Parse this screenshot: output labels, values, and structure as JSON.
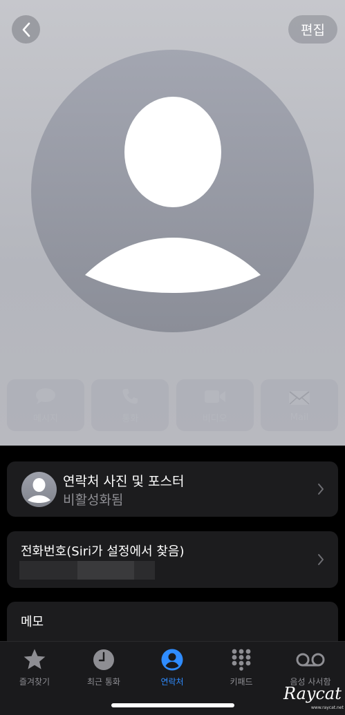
{
  "header": {
    "edit_label": "편집"
  },
  "actions": [
    {
      "label": "메시지",
      "icon": "message-icon"
    },
    {
      "label": "통화",
      "icon": "phone-icon"
    },
    {
      "label": "비디오",
      "icon": "video-icon"
    },
    {
      "label": "Mail",
      "icon": "mail-icon"
    }
  ],
  "photo_card": {
    "title": "연락처 사진 및 포스터",
    "subtitle": "비활성화됨"
  },
  "phone_card": {
    "title": "전화번호(Siri가 설정에서 찾음)"
  },
  "memo_card": {
    "title": "메모"
  },
  "tabbar": {
    "items": [
      {
        "label": "즐겨찾기",
        "icon": "star-icon",
        "active": false
      },
      {
        "label": "최근 통화",
        "icon": "clock-icon",
        "active": false
      },
      {
        "label": "연락처",
        "icon": "person-icon",
        "active": true
      },
      {
        "label": "키패드",
        "icon": "keypad-icon",
        "active": false
      },
      {
        "label": "음성 사서함",
        "icon": "voicemail-icon",
        "active": false
      }
    ]
  },
  "watermark": {
    "text": "Raycat",
    "sub": "www.raycat.net"
  },
  "colors": {
    "accent": "#2f8cff",
    "card_bg": "#1c1c1e",
    "tab_inactive": "#8e8e93"
  }
}
